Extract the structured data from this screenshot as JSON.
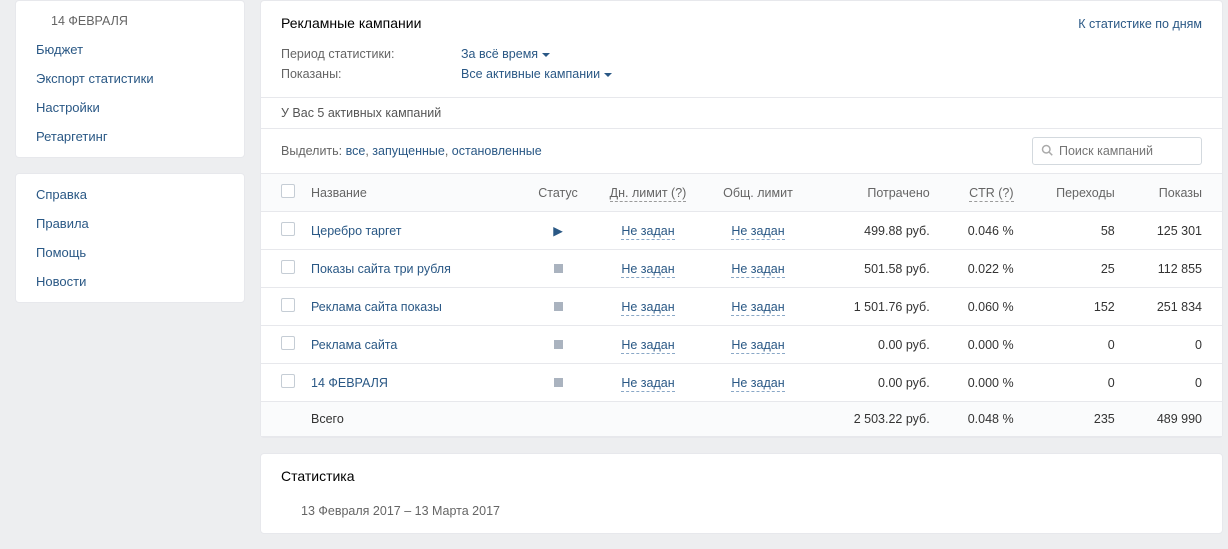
{
  "sidebar": {
    "block1": [
      "14 ФЕВРАЛЯ",
      "Бюджет",
      "Экспорт статистики",
      "Настройки",
      "Ретаргетинг"
    ],
    "block2": [
      "Справка",
      "Правила",
      "Помощь",
      "Новости"
    ]
  },
  "header": {
    "title": "Рекламные кампании",
    "stats_link": "К статистике по дням"
  },
  "filters": {
    "period_label": "Период статистики:",
    "period_value": "За всё время",
    "shown_label": "Показаны:",
    "shown_value": "Все активные кампании"
  },
  "active_note": "У Вас 5 активных кампаний",
  "select": {
    "prefix": "Выделить: ",
    "all": "все",
    "running": "запущенные",
    "stopped": "остановленные",
    "sep": ", "
  },
  "search": {
    "placeholder": "Поиск кампаний"
  },
  "columns": {
    "name": "Название",
    "status": "Статус",
    "day_limit": "Дн. лимит (?)",
    "total_limit": "Общ. лимит",
    "spent": "Потрачено",
    "ctr": "CTR (?)",
    "clicks": "Переходы",
    "impressions": "Показы"
  },
  "rows": [
    {
      "name": "Церебро таргет",
      "status": "play",
      "day_limit": "Не задан",
      "total_limit": "Не задан",
      "spent": "499.88 руб.",
      "ctr": "0.046 %",
      "clicks": "58",
      "impressions": "125 301"
    },
    {
      "name": "Показы сайта три рубля",
      "status": "stop",
      "day_limit": "Не задан",
      "total_limit": "Не задан",
      "spent": "501.58 руб.",
      "ctr": "0.022 %",
      "clicks": "25",
      "impressions": "112 855"
    },
    {
      "name": "Реклама сайта показы",
      "status": "stop",
      "day_limit": "Не задан",
      "total_limit": "Не задан",
      "spent": "1 501.76 руб.",
      "ctr": "0.060 %",
      "clicks": "152",
      "impressions": "251 834"
    },
    {
      "name": "Реклама сайта",
      "status": "stop",
      "day_limit": "Не задан",
      "total_limit": "Не задан",
      "spent": "0.00 руб.",
      "ctr": "0.000 %",
      "clicks": "0",
      "impressions": "0"
    },
    {
      "name": "14 ФЕВРАЛЯ",
      "status": "stop",
      "day_limit": "Не задан",
      "total_limit": "Не задан",
      "spent": "0.00 руб.",
      "ctr": "0.000 %",
      "clicks": "0",
      "impressions": "0"
    }
  ],
  "total": {
    "label": "Всего",
    "spent": "2 503.22 руб.",
    "ctr": "0.048 %",
    "clicks": "235",
    "impressions": "489 990"
  },
  "stats": {
    "title": "Статистика",
    "range": "13 Февраля 2017 – 13 Марта 2017"
  }
}
